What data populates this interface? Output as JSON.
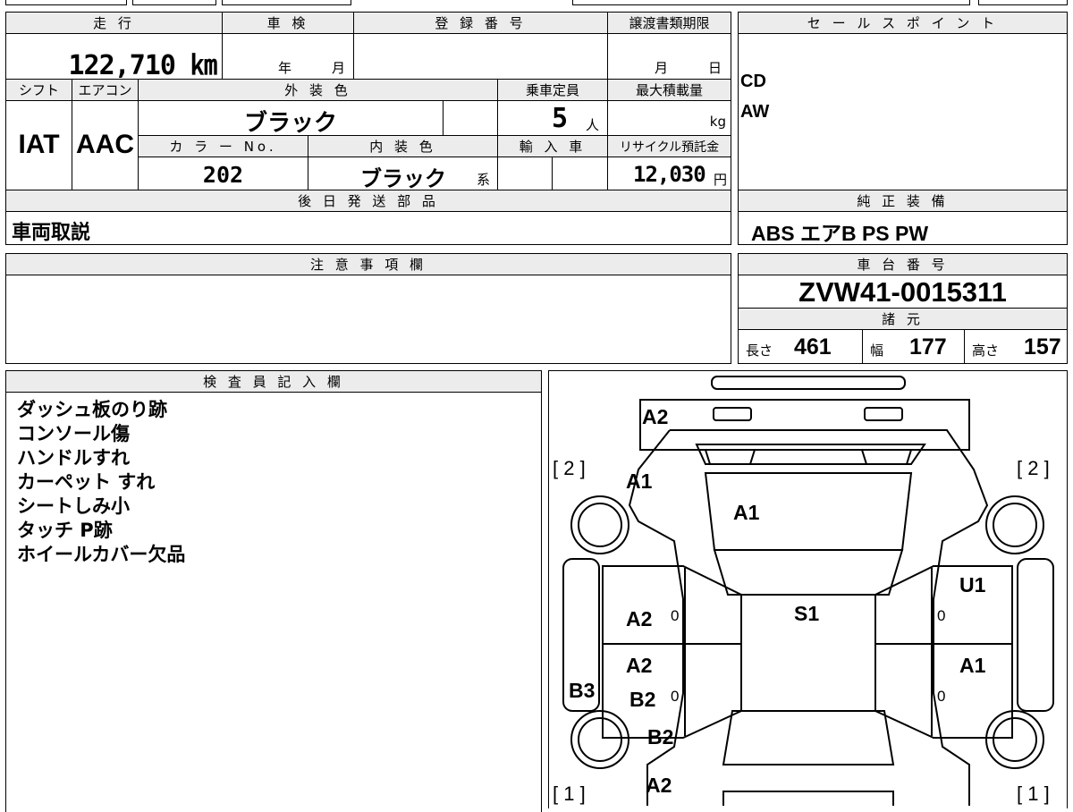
{
  "header": {
    "mileage_label": "走 行",
    "inspection_label": "車 検",
    "registration_label": "登 録 番 号",
    "transfer_deadline_label": "譲渡書類期限"
  },
  "values": {
    "mileage": "122,710 ㎞",
    "inspection_year": "年",
    "inspection_month": "月",
    "deadline_month": "月",
    "deadline_day": "日"
  },
  "row2_labels": {
    "shift": "シフト",
    "aircon": "エアコン",
    "exterior_color": "外 装 色",
    "capacity": "乗車定員",
    "max_load": "最大積載量"
  },
  "row2_values": {
    "shift": "IAT",
    "aircon": "AAC",
    "exterior_color": "ブラック",
    "capacity": "5",
    "capacity_unit": "人",
    "max_load_unit": "kg"
  },
  "row3_labels": {
    "color_no": "カ ラ ー No.",
    "interior_color": "内 装 色",
    "import": "輸 入 車",
    "recycle_deposit": "リサイクル預託金"
  },
  "row3_values": {
    "color_no": "202",
    "interior_color": "ブラック",
    "interior_suffix": "系",
    "recycle_deposit": "12,030",
    "recycle_unit": "円"
  },
  "sales_points": {
    "label": "セ ー ル ス ポ イ ン ト",
    "items": [
      "CD",
      "AW"
    ]
  },
  "later_shipping": {
    "label": "後 日 発 送 部 品",
    "value": "車両取説"
  },
  "genuine_equipment": {
    "label": "純 正 装 備",
    "value": "ABS エアB PS PW"
  },
  "notes": {
    "label": "注 意 事 項 欄",
    "value": ""
  },
  "chassis": {
    "label": "車 台 番 号",
    "value": "ZVW41-0015311",
    "specs_label": "諸 元",
    "length_label": "長さ",
    "length": "461",
    "width_label": "幅",
    "width": "177",
    "height_label": "高さ",
    "height": "157"
  },
  "inspector": {
    "label": "検 査 員 記 入 欄",
    "lines": [
      "ダッシュ板のり跡",
      "コンソール傷",
      "ハンドルすれ",
      "カーペット すれ",
      "シートしみ小",
      "タッチ P跡",
      "ホイールカバー欠品"
    ]
  },
  "diagram": {
    "labels": {
      "hood": "A2",
      "fender_left": "A1",
      "windshield": "A1",
      "door_front_left": "A2",
      "door_rear_left": "A2",
      "pillar_left": "B3",
      "door_rear_left_b": "B2",
      "quarter_left": "B2",
      "rear_left": "A2",
      "roof": "S1",
      "door_front_right": "U1",
      "door_rear_right": "A1"
    },
    "tire_front_left": "[ 2 ]",
    "tire_front_right": "[ 2 ]",
    "tire_rear_left": "[ 1 ]",
    "tire_rear_right": "[ 1 ]",
    "zeros": [
      "0",
      "0",
      "0",
      "0"
    ]
  }
}
